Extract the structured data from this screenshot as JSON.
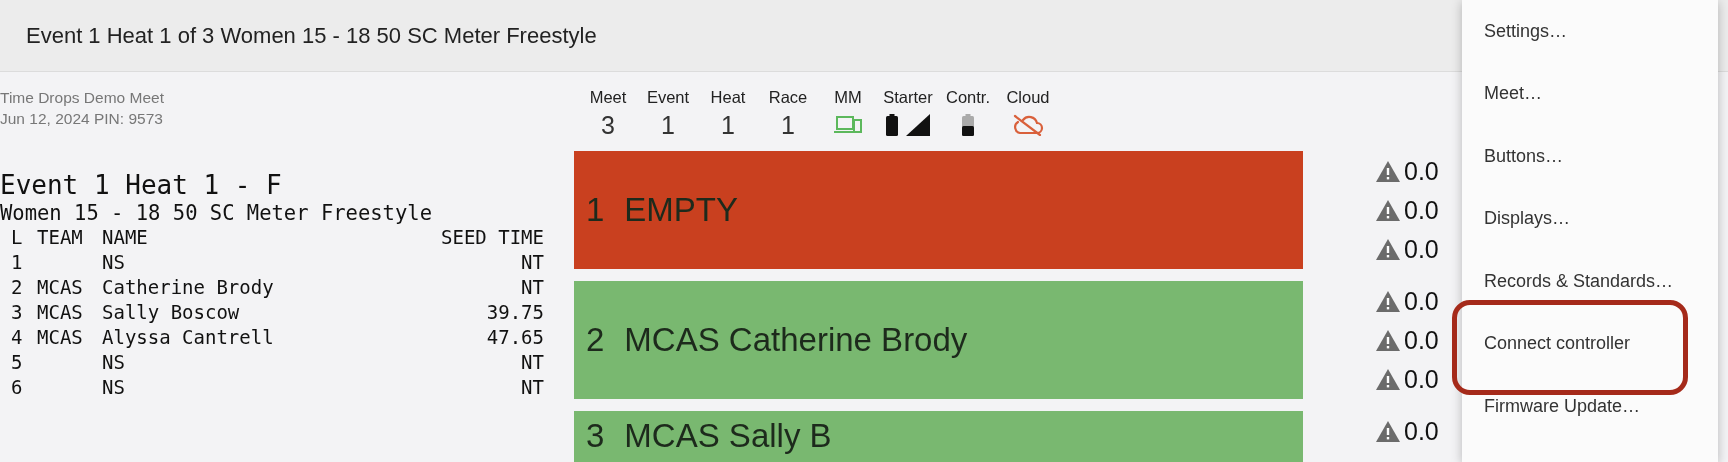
{
  "header": {
    "title": "Event 1 Heat 1 of 3 Women 15 - 18 50 SC Meter Freestyle"
  },
  "meet_info": {
    "name": "Time Drops Demo Meet",
    "details": "Jun 12, 2024 PIN: 9573"
  },
  "heat_sheet": {
    "heading": "Event 1 Heat 1 - F",
    "subtitle": "Women 15 - 18 50 SC Meter Freestyle",
    "columns": [
      "L",
      "TEAM",
      "NAME",
      "SEED TIME"
    ],
    "rows": [
      {
        "lane": "1",
        "name": "NS",
        "seed_time": "NT"
      },
      {
        "lane": "2",
        "team": "MCAS",
        "name": "Catherine Brody",
        "seed_time": "NT"
      },
      {
        "lane": "3",
        "team": "MCAS",
        "name": "Sally Boscow",
        "seed_time": "39.75"
      },
      {
        "lane": "4",
        "team": "MCAS",
        "name": "Alyssa Cantrell",
        "seed_time": "47.65"
      },
      {
        "lane": "5",
        "name": "NS",
        "seed_time": "NT"
      },
      {
        "lane": "6",
        "name": "NS",
        "seed_time": "NT"
      }
    ]
  },
  "status": {
    "counters": [
      {
        "label": "Meet",
        "value": "3"
      },
      {
        "label": "Event",
        "value": "1"
      },
      {
        "label": "Heat",
        "value": "1"
      },
      {
        "label": "Race",
        "value": "1"
      }
    ],
    "devices": [
      {
        "label": "MM",
        "kind": "mm"
      },
      {
        "label": "Starter",
        "kind": "starter"
      },
      {
        "label": "Contr.",
        "kind": "controller"
      },
      {
        "label": "Cloud",
        "kind": "cloud"
      }
    ]
  },
  "lanes": [
    {
      "number": "1",
      "name": "EMPTY",
      "color": "#c9401f",
      "times": [
        "0.0",
        "0.0",
        "0.0"
      ]
    },
    {
      "number": "2",
      "name": "MCAS Catherine Brody",
      "color": "#79b870",
      "times": [
        "0.0",
        "0.0",
        "0.0"
      ]
    },
    {
      "number": "3",
      "name": "MCAS Sally B",
      "color": "#79b870",
      "times": [
        "0.0"
      ]
    }
  ],
  "menu": {
    "items": [
      {
        "label": "Settings…",
        "highlighted": false
      },
      {
        "label": "Meet…",
        "highlighted": false
      },
      {
        "label": "Buttons…",
        "highlighted": false
      },
      {
        "label": "Displays…",
        "highlighted": false
      },
      {
        "label": "Records & Standards…",
        "highlighted": false
      },
      {
        "label": "Connect controller",
        "highlighted": true
      },
      {
        "label": "Firmware Update…",
        "highlighted": false
      }
    ]
  }
}
